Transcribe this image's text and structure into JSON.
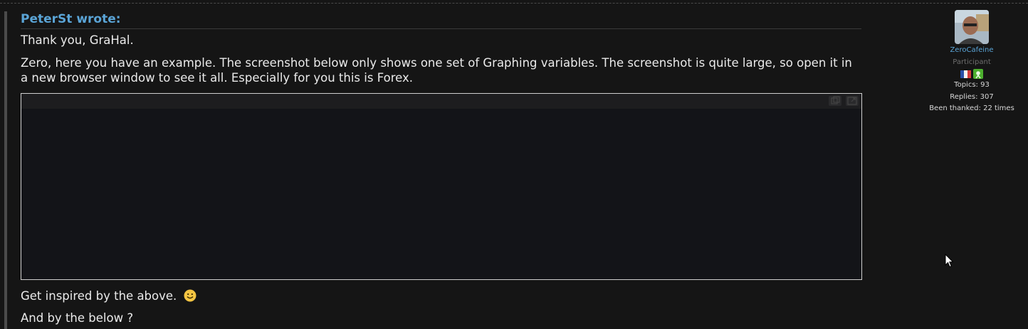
{
  "quote": {
    "author_label": "PeterSt wrote:",
    "paragraphs": [
      "Thank you, GraHal.",
      "Zero, here you have an example. The screenshot below only shows one set of Graphing variables. The screenshot is quite large, so open it in a new browser window to see it all. Especially for you this is Forex."
    ]
  },
  "post": {
    "line1": "Get inspired by the above.",
    "line2": "And by the below ?"
  },
  "user_card": {
    "username": "ZeroCafeine",
    "role": "Participant",
    "topics": "Topics: 93",
    "replies": "Replies: 307",
    "thanked": "Been thanked: 22 times"
  },
  "icons": {
    "smiley": "smiley-emoji-icon",
    "flag": "france-flag-icon",
    "rank": "rank-badge-icon",
    "copy": "copy-icon",
    "open_window": "open-new-window-icon",
    "cursor": "mouse-pointer-icon"
  },
  "colors": {
    "link": "#5aa4d6",
    "text": "#eaeaea",
    "background": "#151515",
    "rank_badge": "#4caf2e"
  }
}
